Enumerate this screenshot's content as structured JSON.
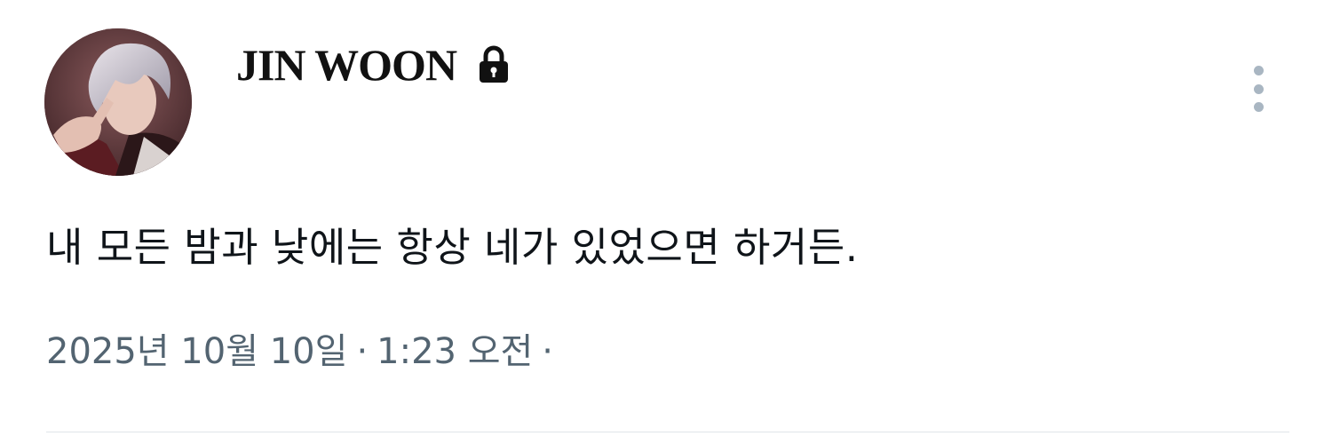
{
  "user": {
    "display_name": "JIN WOON",
    "protected_icon": "lock-icon",
    "avatar_icon": "profile-photo"
  },
  "tweet": {
    "text": "내 모든 밤과 낮에는 항상 네가 있었으면 하거든.",
    "date": "2025년 10월 10일",
    "separator": "·",
    "time": "1:23 오전"
  },
  "actions": {
    "more_icon": "more-vertical-icon"
  },
  "colors": {
    "name": "#111111",
    "text": "#0f1419",
    "meta": "#536471",
    "more_dots": "#a9b6c2",
    "divider": "#dfe5e9"
  }
}
